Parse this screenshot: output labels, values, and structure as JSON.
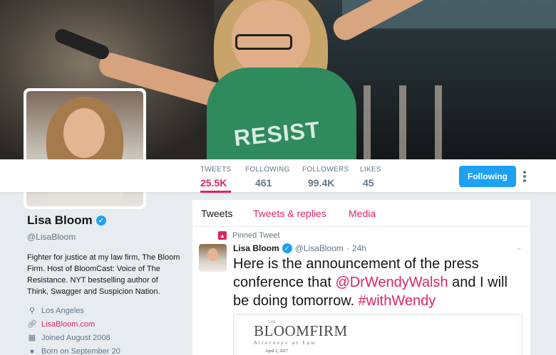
{
  "profile": {
    "name": "Lisa Bloom",
    "handle": "@LisaBloom",
    "bio": "Fighter for justice at my law firm, The Bloom Firm. Host of BloomCast: Voice of The Resistance. NYT bestselling author of Think, Swagger and Suspicion Nation.",
    "location": "Los Angeles",
    "website": "LisaBloom.com",
    "joined": "Joined August 2008",
    "born": "Born on September 20"
  },
  "banner": {
    "shirt_text": "RESIST"
  },
  "stats": [
    {
      "label": "TWEETS",
      "value": "25.5K"
    },
    {
      "label": "FOLLOWING",
      "value": "461"
    },
    {
      "label": "FOLLOWERS",
      "value": "99.4K"
    },
    {
      "label": "LIKES",
      "value": "45"
    }
  ],
  "actions": {
    "follow_label": "Following"
  },
  "tabs": [
    {
      "label": "Tweets"
    },
    {
      "label": "Tweets & replies"
    },
    {
      "label": "Media"
    }
  ],
  "tweet": {
    "pinned_label": "Pinned Tweet",
    "author": "Lisa Bloom",
    "handle": "@LisaBloom",
    "separator": "·",
    "time": "24h",
    "text_before": "Here is the announcement of the press conference that ",
    "mention": "@DrWendyWalsh",
    "text_middle": " and I will be doing tomorrow. ",
    "hashtag": "#withWendy"
  },
  "card": {
    "logo_small": "THE",
    "logo": "BLOOMFIRM",
    "subtitle": "Attorneys at Law",
    "date": "April 2, 2017"
  },
  "colors": {
    "accent": "#e0245e",
    "follow_button": "#1da1f2",
    "muted": "#657786"
  }
}
